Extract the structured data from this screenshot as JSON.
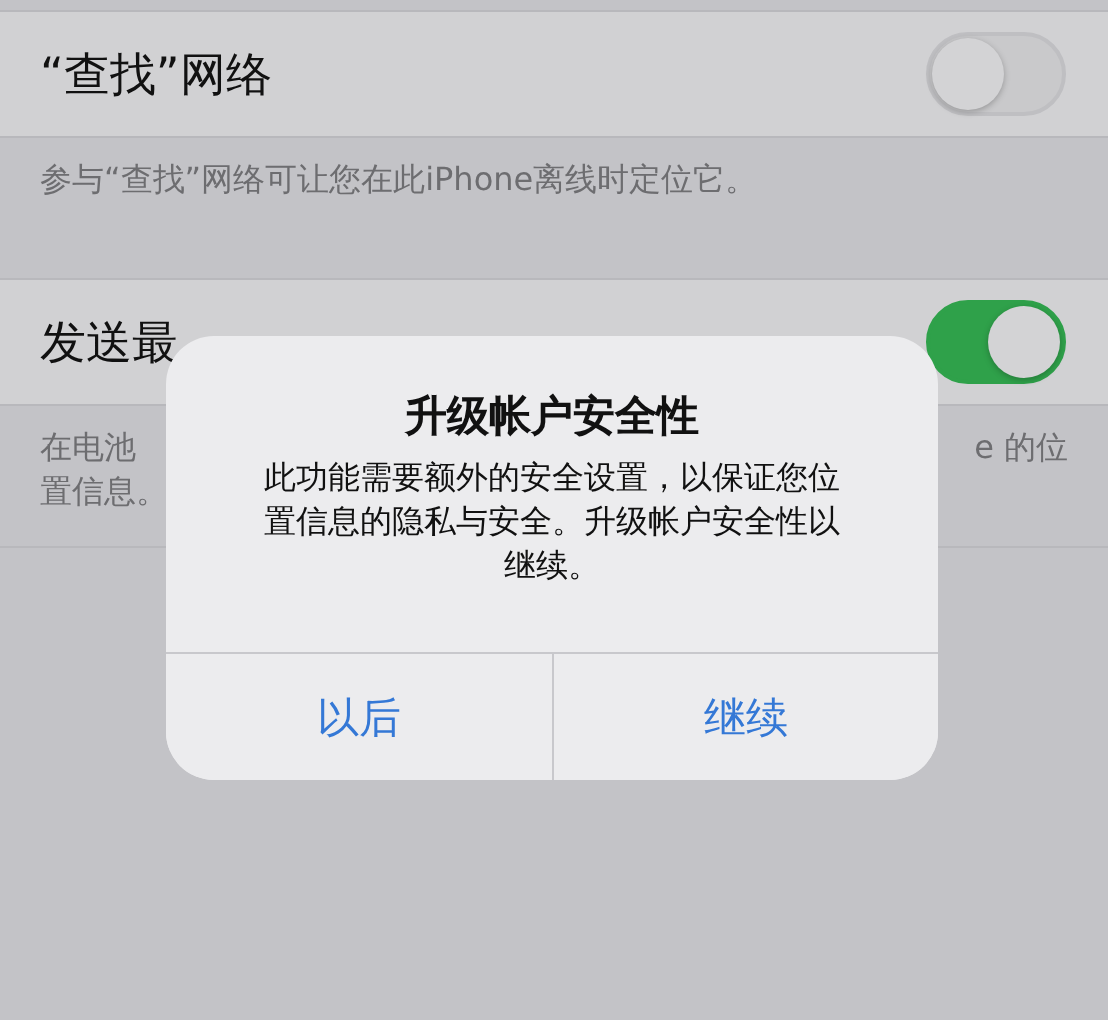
{
  "settings": [
    {
      "label": "“查找”网络",
      "on": false,
      "footer_lines": [
        [
          "参与“查找”网络可让您在此iPhone离线时定位它。"
        ]
      ]
    },
    {
      "label": "发送最",
      "on": true,
      "footer_lines": [
        [
          "在电池",
          "e 的位"
        ],
        [
          "置信息。"
        ]
      ]
    }
  ],
  "alert": {
    "title": "升级帐户安全性",
    "message": "此功能需要额外的安全设置，以保证您位置信息的隐私与安全。升级帐户安全性以继续。",
    "buttons": [
      {
        "label": "以后"
      },
      {
        "label": "继续"
      }
    ]
  }
}
